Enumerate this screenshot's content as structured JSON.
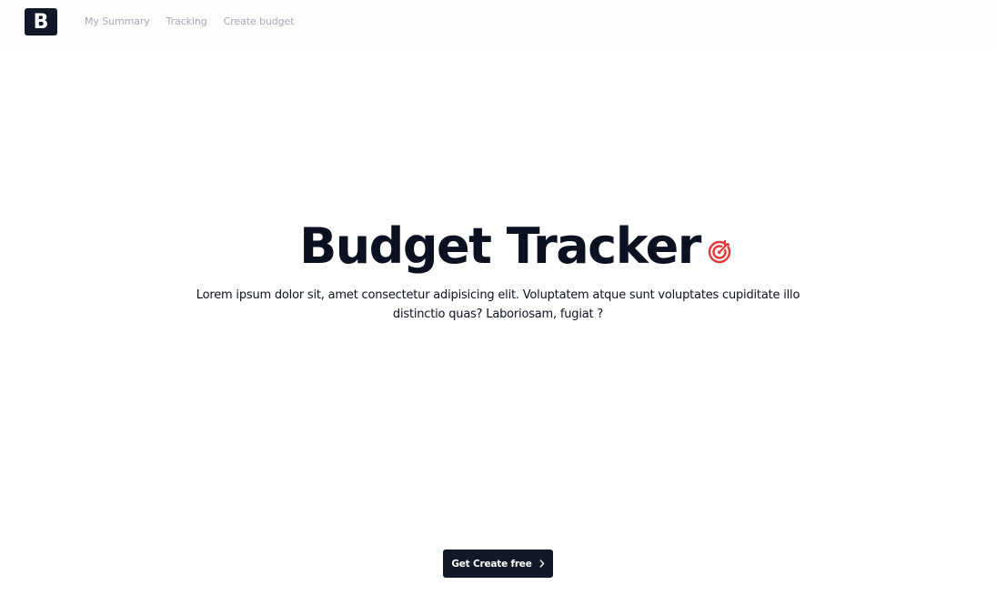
{
  "header": {
    "logo_letter": "B",
    "nav": [
      {
        "label": "My Summary"
      },
      {
        "label": "Tracking"
      },
      {
        "label": "Create budget"
      }
    ]
  },
  "hero": {
    "title": "Budget Tracker",
    "title_icon": "target-arrow-icon",
    "description": "Lorem ipsum dolor sit, amet consectetur adipisicing elit. Voluptatem atque sunt voluptates cupiditate illo distinctio quas? Laboriosam, fugiat ?"
  },
  "cta": {
    "label": "Get Create free",
    "icon": "chevron-right-icon"
  },
  "colors": {
    "primary_dark": "#111827",
    "nav_text": "#a7a9b7",
    "accent_red": "#e5383b",
    "text": "#0b1120"
  }
}
